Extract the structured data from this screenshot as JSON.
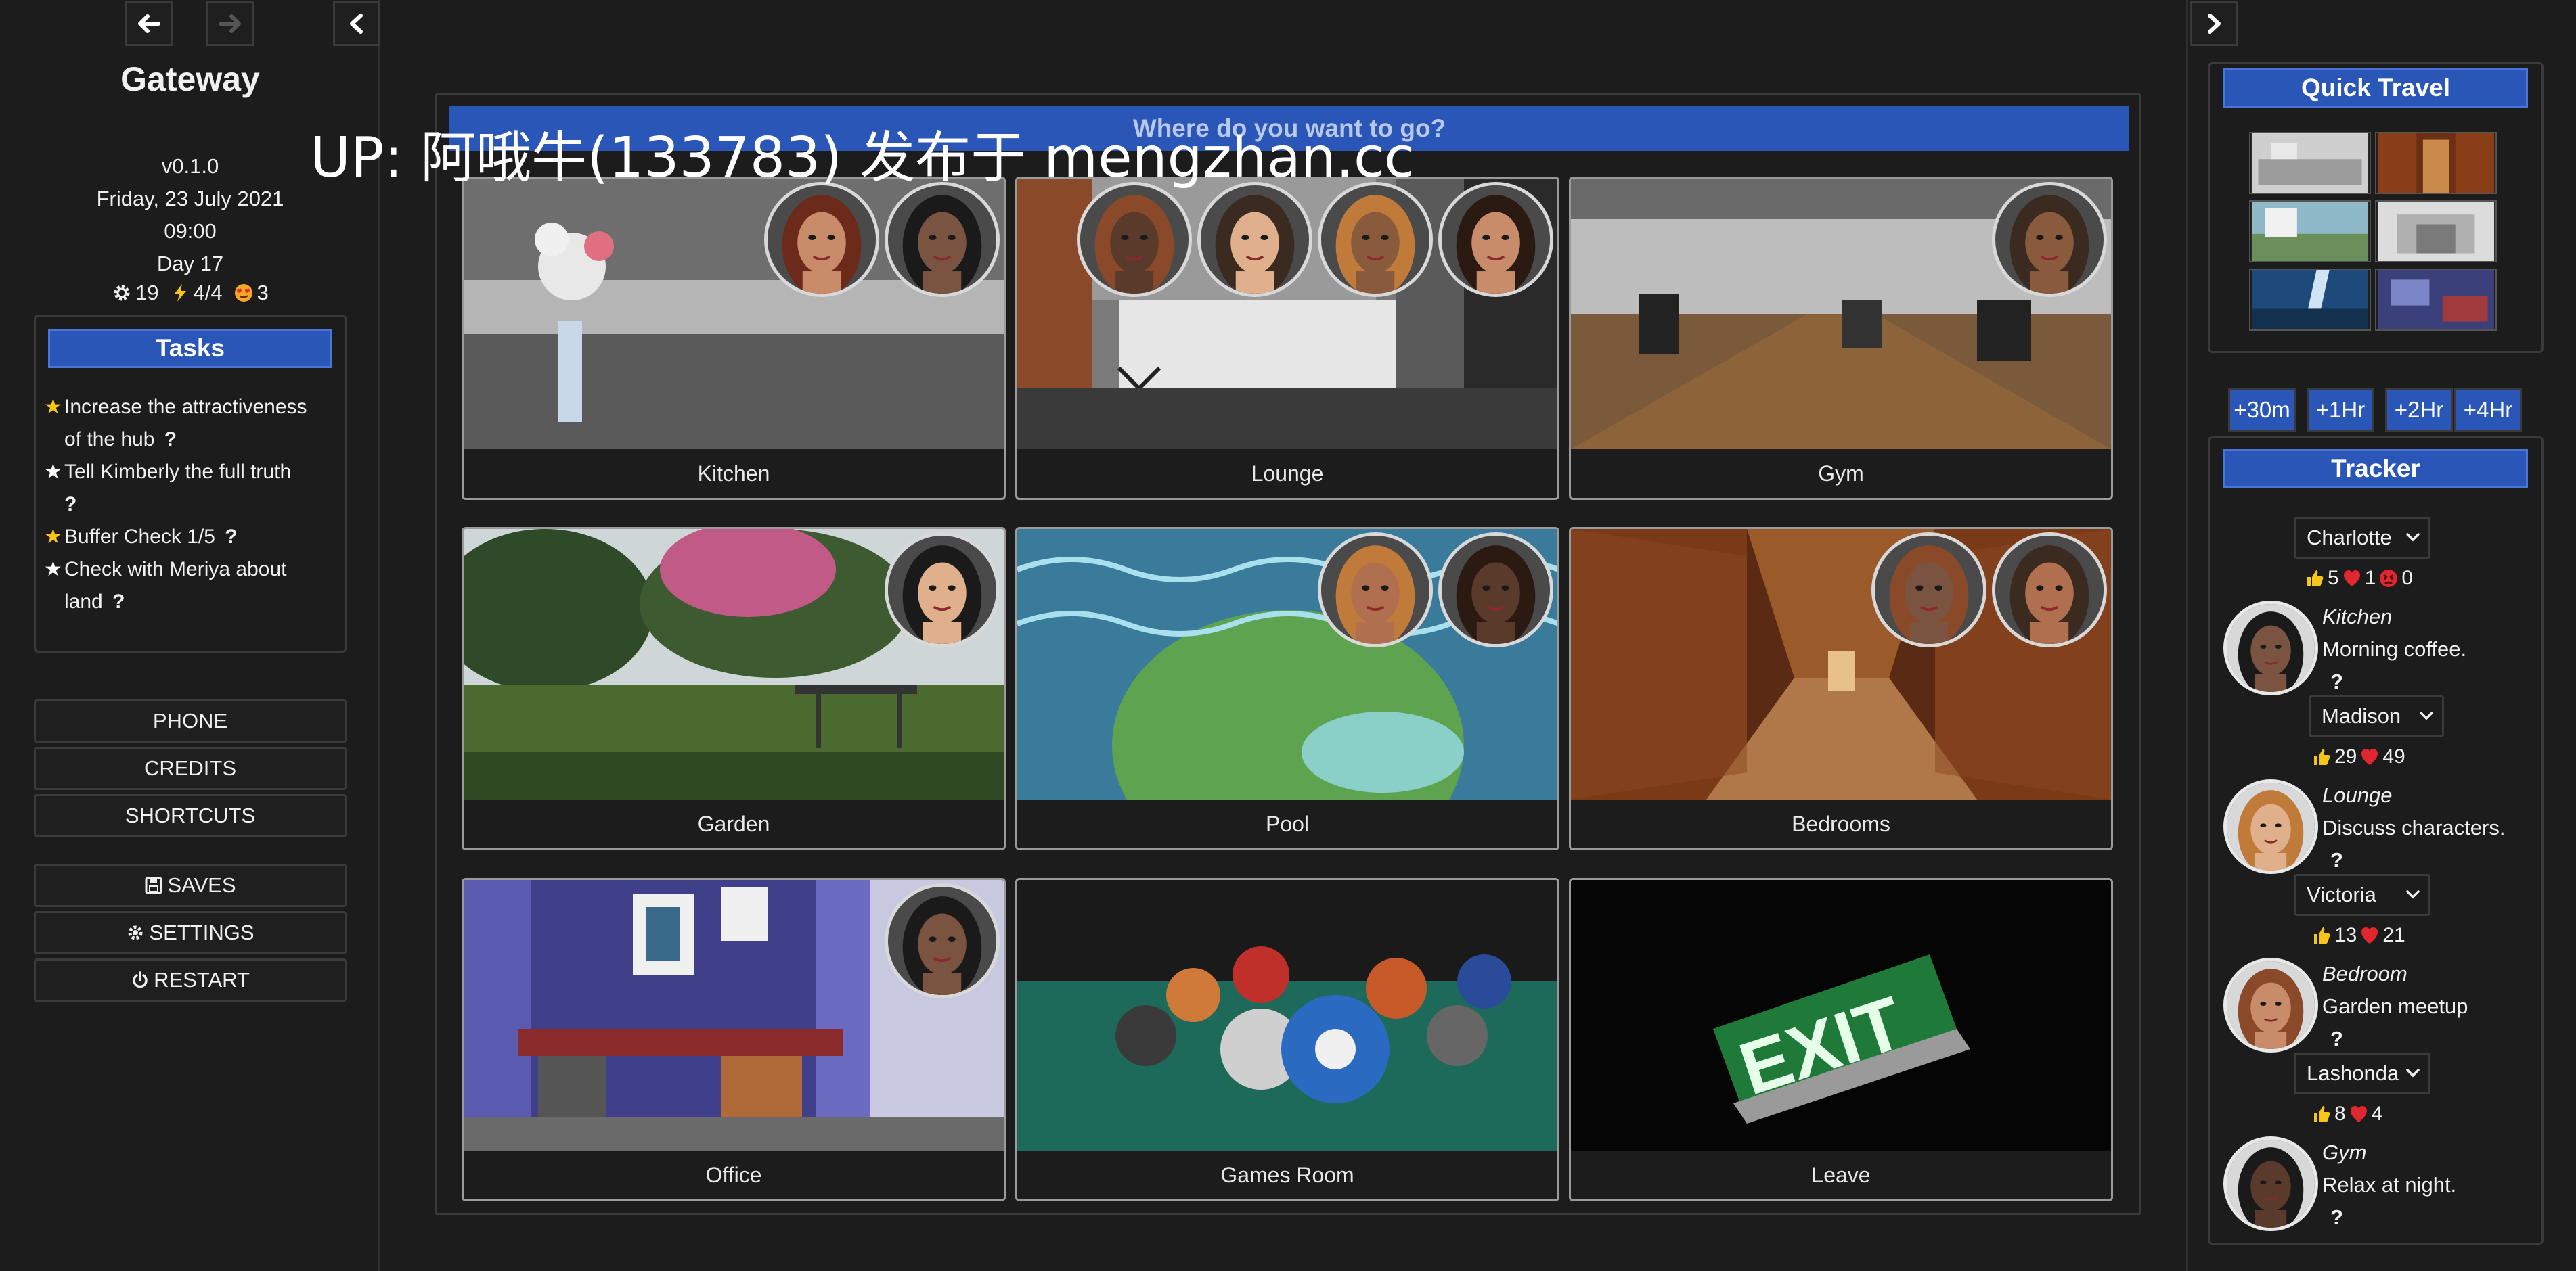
{
  "sidebar": {
    "title": "Gateway",
    "version": "v0.1.0",
    "date": "Friday, 23 July 2021",
    "time": "09:00",
    "day": "Day 17",
    "stats": {
      "gear": "19",
      "energy": "4/4",
      "love": "3"
    },
    "tasks_header": "Tasks",
    "tasks": [
      {
        "line1": "Increase the attractiveness",
        "line2": "of the hub",
        "highlighted": true
      },
      {
        "line1": "Tell Kimberly the full truth",
        "line2": "",
        "highlighted": false
      },
      {
        "line1": "Buffer Check 1/5",
        "line2": "",
        "highlighted": true
      },
      {
        "line1": "Check with Meriya about",
        "line2": "land",
        "highlighted": false
      }
    ],
    "help_mark": "?",
    "menu": [
      "PHONE",
      "CREDITS",
      "SHORTCUTS"
    ],
    "menu2": {
      "saves": "SAVES",
      "settings": "SETTINGS",
      "restart": "RESTART"
    }
  },
  "main": {
    "header": "Where do you want to go?",
    "locations": [
      {
        "label": "Kitchen",
        "scene": "kitchen",
        "portraits": 2
      },
      {
        "label": "Lounge",
        "scene": "lounge",
        "portraits": 4
      },
      {
        "label": "Gym",
        "scene": "gym",
        "portraits": 1
      },
      {
        "label": "Garden",
        "scene": "garden",
        "portraits": 1
      },
      {
        "label": "Pool",
        "scene": "pool",
        "portraits": 2
      },
      {
        "label": "Bedrooms",
        "scene": "bedrooms",
        "portraits": 2
      },
      {
        "label": "Office",
        "scene": "office",
        "portraits": 1
      },
      {
        "label": "Games Room",
        "scene": "games",
        "portraits": 0
      },
      {
        "label": "Leave",
        "scene": "exit",
        "portraits": 0
      }
    ],
    "watermark": "UP: 阿哦牛(133783) 发布于 mengzhan.cc"
  },
  "quick_travel": {
    "header": "Quick Travel"
  },
  "time_buttons": [
    "+30m",
    "+1Hr",
    "+2Hr",
    "+4Hr"
  ],
  "tracker": {
    "header": "Tracker",
    "characters": [
      {
        "name": "Charlotte",
        "like": "5",
        "love": "1",
        "angry": "0",
        "location": "Kitchen",
        "activity": "Morning coffee."
      },
      {
        "name": "Madison",
        "like": "29",
        "love": "49",
        "location": "Lounge",
        "activity": "Discuss characters."
      },
      {
        "name": "Victoria",
        "like": "13",
        "love": "21",
        "location": "Bedroom",
        "activity": "Garden meetup"
      },
      {
        "name": "Lashonda",
        "like": "8",
        "love": "4",
        "location": "Gym",
        "activity": "Relax at night."
      }
    ]
  },
  "colors": {
    "accent": "#2a56b8",
    "background": "#1c1c1c",
    "border": "#3a3a3a",
    "star": "#f5c518",
    "heart": "#e0262e"
  }
}
